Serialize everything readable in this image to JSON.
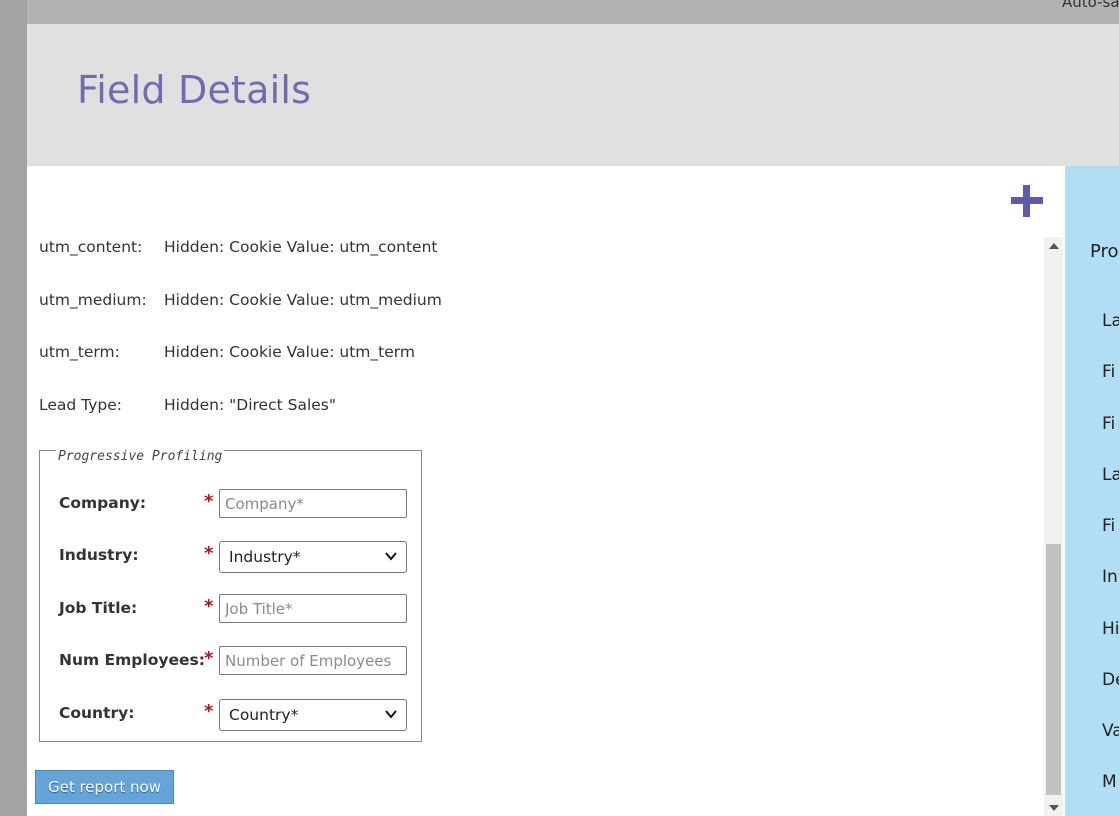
{
  "topbar": {
    "autosave_text": "Auto-sa"
  },
  "header": {
    "title": "Field Details"
  },
  "toolbar": {
    "add_icon": "plus-icon"
  },
  "hidden_fields": [
    {
      "label": "utm_content:",
      "value": "Hidden: Cookie Value: utm_content"
    },
    {
      "label": "utm_medium:",
      "value": "Hidden: Cookie Value: utm_medium"
    },
    {
      "label": "utm_term:",
      "value": "Hidden: Cookie Value: utm_term"
    },
    {
      "label": "Lead Type:",
      "value": "Hidden: \"Direct Sales\""
    }
  ],
  "progressive_profiling": {
    "legend": "Progressive Profiling",
    "required_mark": "*",
    "fields": {
      "company": {
        "label": "Company:",
        "placeholder": "Company*"
      },
      "industry": {
        "label": "Industry:",
        "selected": "Industry*"
      },
      "job_title": {
        "label": "Job Title:",
        "placeholder": "Job Title*"
      },
      "num_employees": {
        "label": "Num Employees:",
        "placeholder": "Number of Employees"
      },
      "country": {
        "label": "Country:",
        "selected": "Country*"
      }
    }
  },
  "submit": {
    "label": "Get report now"
  },
  "right_panel": {
    "title": "Pro",
    "items": [
      "La",
      "Fi",
      "Fi",
      "La",
      "Fi",
      "In",
      "Hi",
      "De",
      "Va",
      "M"
    ]
  },
  "colors": {
    "title": "#6f6dad",
    "accent_icon": "#5d5ca9",
    "button": "#64a4d9",
    "required": "#b0131d",
    "panel": "#b1def4"
  }
}
